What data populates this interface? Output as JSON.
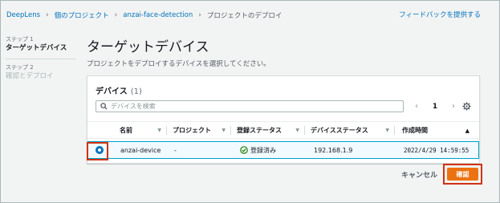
{
  "breadcrumb": {
    "items": [
      "DeepLens",
      "個のプロジェクト",
      "anzai-face-detection"
    ],
    "current": "プロジェクトのデプロイ",
    "separator": "›"
  },
  "feedback_link": "フィードバックを提供する",
  "steps": [
    {
      "label": "ステップ 1",
      "title": "ターゲットデバイス",
      "active": true
    },
    {
      "label": "ステップ 2",
      "title": "確認とデプロイ",
      "active": false
    }
  ],
  "page": {
    "title": "ターゲットデバイス",
    "description": "プロジェクトをデプロイするデバイスを選択してください。"
  },
  "panel": {
    "title": "デバイス",
    "count": "(1)",
    "search_placeholder": "デバイスを検索",
    "pager": {
      "prev": "‹",
      "page": "1",
      "next": "›"
    }
  },
  "table": {
    "columns": [
      "名前",
      "プロジェクト",
      "登録ステータス",
      "デバイスステータス",
      "作成時間"
    ],
    "rows": [
      {
        "selected": true,
        "name": "anzai-device",
        "project": "-",
        "registration_status": "登録済み",
        "device_status": "192.168.1.9",
        "created": "2022/4/29 14:59:55"
      }
    ]
  },
  "actions": {
    "cancel": "キャンセル",
    "confirm": "確認"
  },
  "colors": {
    "link": "#0073bb",
    "primary_button": "#ec7211",
    "selection_border": "#00a1c9",
    "highlight": "#d13212",
    "success": "#1d8102"
  }
}
